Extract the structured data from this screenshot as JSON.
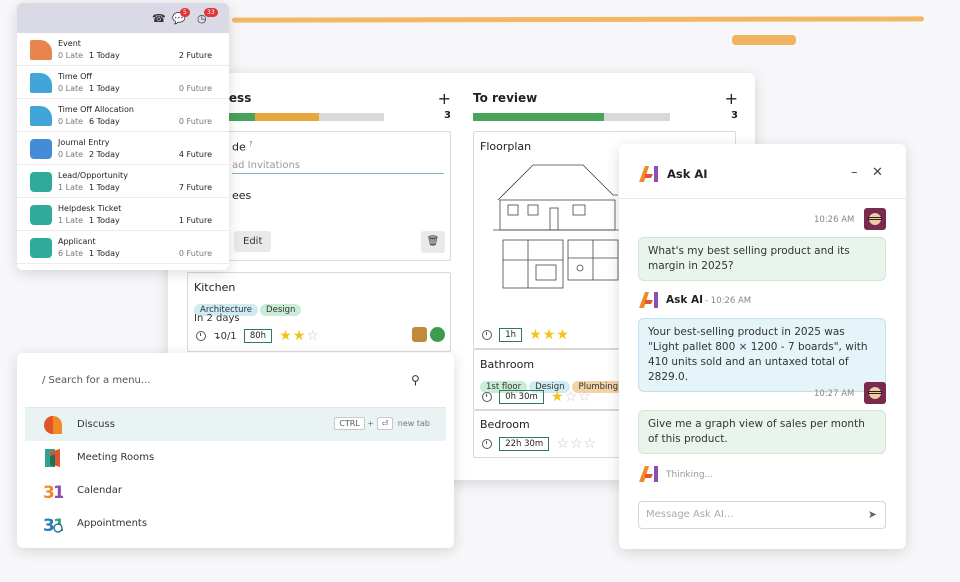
{
  "activity": {
    "header_icons": [
      {
        "icon": "phone-icon",
        "badge": ""
      },
      {
        "icon": "chat-icon",
        "badge": "5"
      },
      {
        "icon": "clock-icon",
        "badge": "33"
      }
    ],
    "rows": [
      {
        "name": "Event",
        "late": "0 Late",
        "today": "1 Today",
        "future": "2 Future",
        "icon": "event-icon",
        "color": "#e8773a",
        "future_muted": false
      },
      {
        "name": "Time Off",
        "late": "0 Late",
        "today": "1 Today",
        "future": "0 Future",
        "icon": "umbrella-icon",
        "color": "#2d9bd6",
        "future_muted": true
      },
      {
        "name": "Time Off Allocation",
        "late": "0 Late",
        "today": "6 Today",
        "future": "0 Future",
        "icon": "umbrella-icon",
        "color": "#2d9bd6",
        "future_muted": true
      },
      {
        "name": "Journal Entry",
        "late": "0 Late",
        "today": "2 Today",
        "future": "4 Future",
        "icon": "invoice-icon",
        "color": "#2d7fd6",
        "future_muted": false
      },
      {
        "name": "Lead/Opportunity",
        "late": "1 Late",
        "today": "1 Today",
        "future": "7 Future",
        "icon": "crm-icon",
        "color": "#1aa18f",
        "future_muted": false
      },
      {
        "name": "Helpdesk Ticket",
        "late": "1 Late",
        "today": "1 Today",
        "future": "1 Future",
        "icon": "helpdesk-icon",
        "color": "#1aa18f",
        "future_muted": false
      },
      {
        "name": "Applicant",
        "late": "6 Late",
        "today": "1 Today",
        "future": "0 Future",
        "icon": "recruitment-icon",
        "color": "#1aa18f",
        "future_muted": true
      }
    ]
  },
  "kanban": {
    "col1": {
      "title": "ress",
      "count": "3",
      "card1": {
        "title": "de",
        "help": "?",
        "field_placeholder": "ad Invitations",
        "sub": "ees",
        "edit_label": "Edit"
      },
      "card2": {
        "title": "Kitchen",
        "tags": [
          "Architecture",
          "Design"
        ],
        "deadline": "In 2 days",
        "subtasks": "0/1",
        "time": "80h",
        "stars": 2
      }
    },
    "col2": {
      "title": "To review",
      "count": "3",
      "card1": {
        "title": "Floorplan",
        "time": "1h",
        "stars": 3
      },
      "card2": {
        "title": "Bathroom",
        "tags": [
          "1st floor",
          "Design",
          "Plumbing"
        ],
        "time": "0h 30m",
        "stars": 1
      },
      "card3": {
        "title": "Bedroom",
        "time": "22h 30m",
        "stars": 0
      }
    }
  },
  "menu": {
    "placeholder": "/ Search for a menu...",
    "items": [
      {
        "label": "Discuss",
        "icon": "discuss-icon"
      },
      {
        "label": "Meeting Rooms",
        "icon": "meeting-rooms-icon"
      },
      {
        "label": "Calendar",
        "icon": "calendar-icon"
      },
      {
        "label": "Appointments",
        "icon": "appointments-icon"
      }
    ],
    "shortcut": {
      "key1": "CTRL",
      "plus": "+",
      "key2": "⏎",
      "text": "new tab"
    }
  },
  "chat": {
    "title": "Ask AI",
    "messages": [
      {
        "time": "10:26 AM",
        "text": "What's my best selling product and its margin in 2025?"
      },
      {
        "author": "Ask AI",
        "sep": "-",
        "time": "10:26 AM",
        "text": "Your best-selling product in 2025 was \"Light pallet 800 × 1200 - 7 boards\", with 410 units sold and an untaxed total of 2829.0."
      },
      {
        "time": "10:27 AM",
        "text": "Give me a graph view of sales per month of this product."
      }
    ],
    "thinking": "Thinking...",
    "input_placeholder": "Message Ask AI..."
  },
  "colors": {
    "green": "#4aa35a",
    "orange": "#e6a83e",
    "gray": "#d9d9d9",
    "tag_green": "#c8ecd6",
    "tag_blue": "#cdebf0",
    "tag_orange": "#f4d2a8"
  }
}
